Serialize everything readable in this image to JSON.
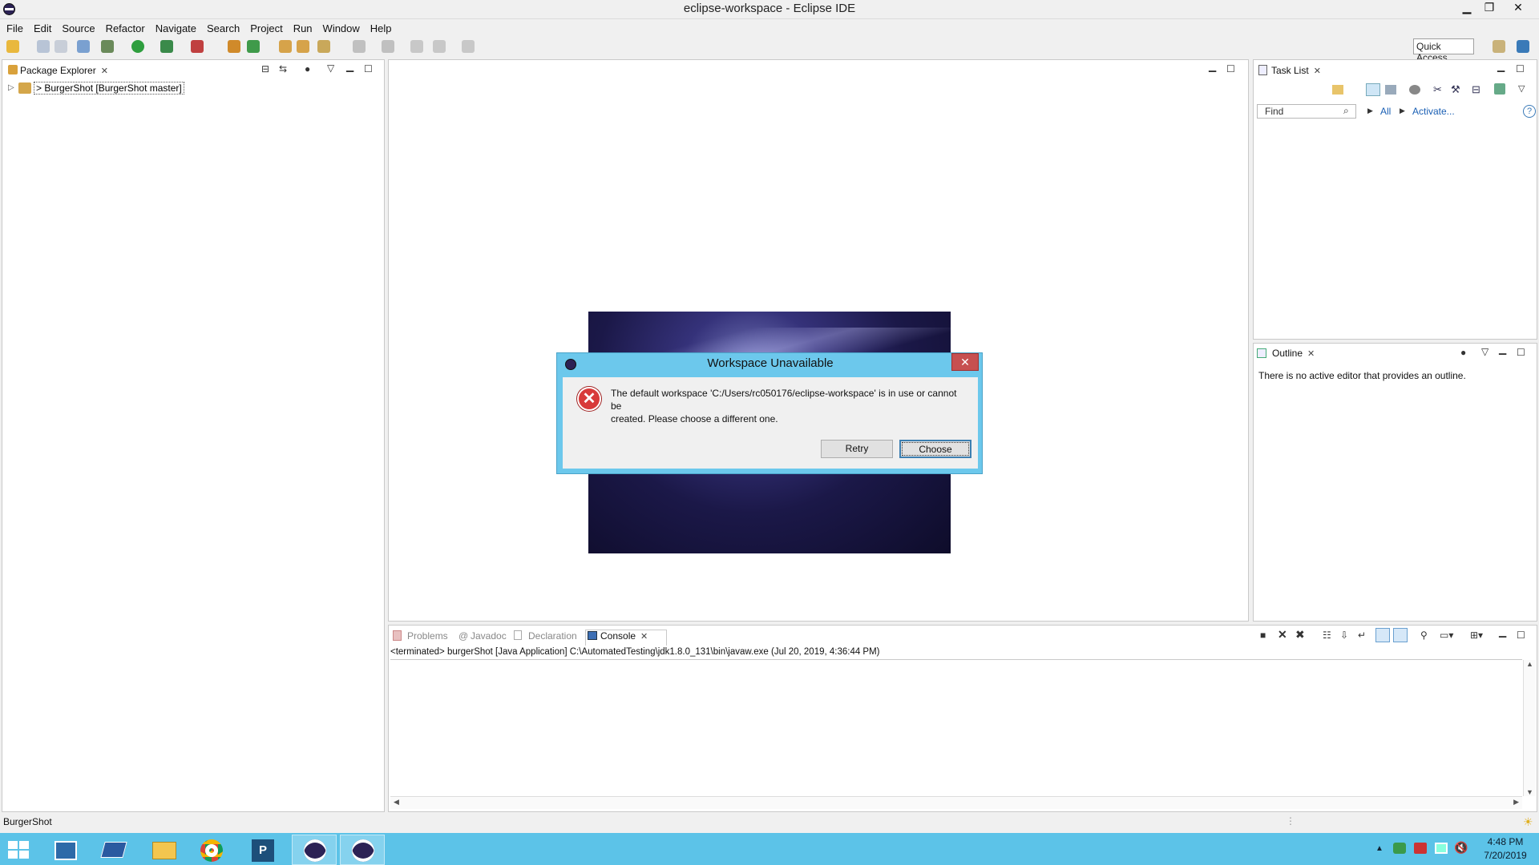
{
  "window": {
    "title": "eclipse-workspace - Eclipse IDE"
  },
  "menu": [
    "File",
    "Edit",
    "Source",
    "Refactor",
    "Navigate",
    "Search",
    "Project",
    "Run",
    "Window",
    "Help"
  ],
  "toolbar": {
    "quick_access_label": "Quick Access"
  },
  "package_explorer": {
    "tab_label": "Package Explorer",
    "tree": [
      {
        "label": "> BurgerShot [BurgerShot master]"
      }
    ]
  },
  "task_list": {
    "tab_label": "Task List",
    "find_placeholder": "Find",
    "filter_all": "All",
    "activate": "Activate..."
  },
  "outline": {
    "tab_label": "Outline",
    "empty_message": "There is no active editor that provides an outline."
  },
  "bottom_tabs": {
    "problems": "Problems",
    "javadoc": "Javadoc",
    "declaration": "Declaration",
    "console": "Console"
  },
  "console": {
    "header": "<terminated> burgerShot [Java Application] C:\\AutomatedTesting\\jdk1.8.0_131\\bin\\javaw.exe (Jul 20, 2019, 4:36:44 PM)"
  },
  "status_bar": {
    "selection": "BurgerShot"
  },
  "dialog": {
    "title": "Workspace Unavailable",
    "message_line1": "The default workspace 'C:/Users/rc050176/eclipse-workspace' is in use or cannot be",
    "message_line2": "created. Please choose a different one.",
    "retry_label": "Retry",
    "choose_label": "Choose"
  },
  "taskbar": {
    "apps": [
      "windows-start-icon",
      "server-manager-icon",
      "powershell-icon",
      "file-explorer-icon",
      "chrome-icon",
      "pu-app-icon",
      "eclipse-icon",
      "eclipse-icon"
    ],
    "time": "4:48 PM",
    "date": "7/20/2019"
  },
  "colors": {
    "accent": "#6cc8ec",
    "taskbar": "#5cc3e8",
    "error": "#d83a3a"
  }
}
